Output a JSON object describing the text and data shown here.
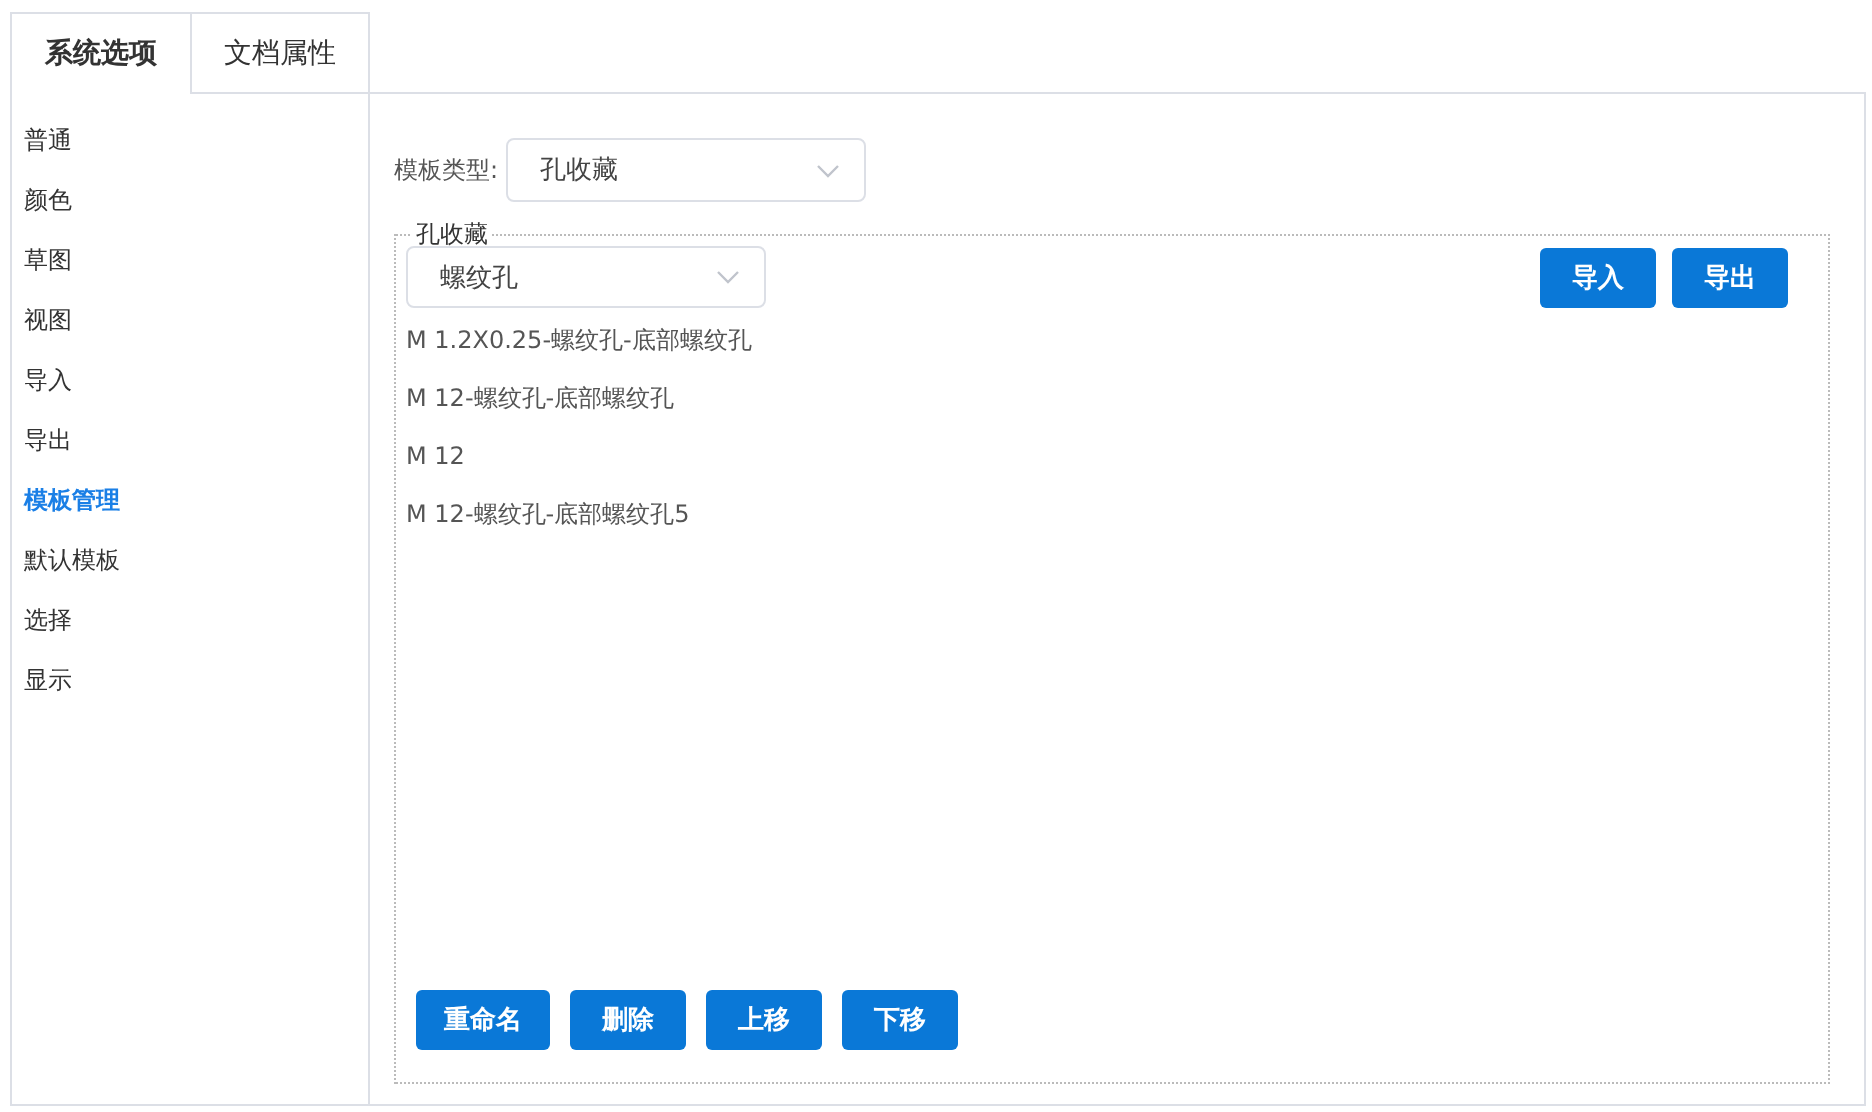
{
  "tabs": [
    {
      "label": "系统选项",
      "selected": true
    },
    {
      "label": "文档属性",
      "selected": false
    }
  ],
  "sidebar": {
    "items": [
      {
        "label": "普通",
        "selected": false
      },
      {
        "label": "颜色",
        "selected": false
      },
      {
        "label": "草图",
        "selected": false
      },
      {
        "label": "视图",
        "selected": false
      },
      {
        "label": "导入",
        "selected": false
      },
      {
        "label": "导出",
        "selected": false
      },
      {
        "label": "模板管理",
        "selected": true
      },
      {
        "label": "默认模板",
        "selected": false
      },
      {
        "label": "选择",
        "selected": false
      },
      {
        "label": "显示",
        "selected": false
      }
    ]
  },
  "template_type": {
    "label": "模板类型:",
    "value": "孔收藏"
  },
  "group": {
    "legend": "孔收藏",
    "filter": {
      "value": "螺纹孔"
    },
    "top_buttons": [
      "导入",
      "导出"
    ],
    "items": [
      "M 1.2X0.25-螺纹孔-底部螺纹孔",
      "M 12-螺纹孔-底部螺纹孔",
      "M 12",
      "M 12-螺纹孔-底部螺纹孔5"
    ],
    "bottom_buttons": [
      "重命名",
      "删除",
      "上移",
      "下移"
    ]
  }
}
